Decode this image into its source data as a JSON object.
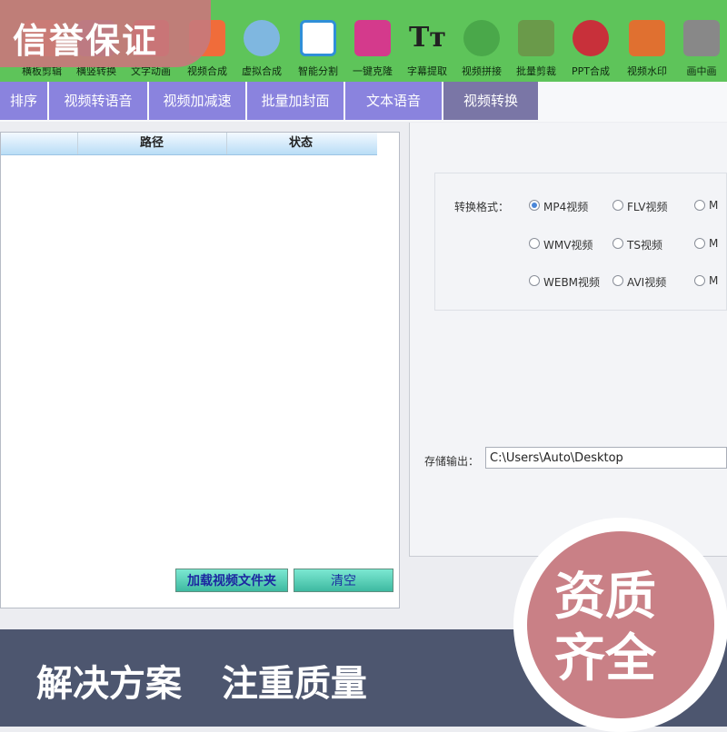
{
  "toolbar": {
    "items": [
      {
        "label": "横板剪辑",
        "icon": "clip-icon"
      },
      {
        "label": "横竖转换",
        "icon": "rotate-icon"
      },
      {
        "label": "文字动画",
        "icon": "text-animation-icon"
      },
      {
        "label": "视频合成",
        "icon": "video-merge-icon"
      },
      {
        "label": "虚拟合成",
        "icon": "virtual-avatar-icon"
      },
      {
        "label": "智能分割",
        "icon": "split-icon"
      },
      {
        "label": "一键克隆",
        "icon": "clone-icon"
      },
      {
        "label": "字幕提取",
        "icon": "subtitle-icon"
      },
      {
        "label": "视频拼接",
        "icon": "stitch-icon"
      },
      {
        "label": "批量剪裁",
        "icon": "crop-icon"
      },
      {
        "label": "PPT合成",
        "icon": "ppt-icon"
      },
      {
        "label": "视频水印",
        "icon": "watermark-icon"
      },
      {
        "label": "画中画",
        "icon": "pip-icon"
      }
    ],
    "colors": [
      "#e89a3a",
      "#3a8fd8",
      "#d94b4b",
      "#f06c3a",
      "#7fb7e0",
      "#2f8fd8",
      "#d43a8c",
      "#222222",
      "#4aa84a",
      "#6a9a4a",
      "#c8303a",
      "#e07030",
      "#888888"
    ]
  },
  "tabs": [
    {
      "label": "排序"
    },
    {
      "label": "视频转语音"
    },
    {
      "label": "视频加减速"
    },
    {
      "label": "批量加封面"
    },
    {
      "label": "文本语音"
    },
    {
      "label": "视频转换",
      "active": true
    }
  ],
  "file_list": {
    "columns": [
      "路径",
      "状态"
    ],
    "load_button": "加载视频文件夹",
    "clear_button": "清空"
  },
  "format": {
    "label": "转换格式：",
    "options": [
      "MP4视频",
      "FLV视频",
      "M",
      "WMV视频",
      "TS视频",
      "M",
      "WEBM视频",
      "AVI视频",
      "M"
    ],
    "selected": "MP4视频"
  },
  "output": {
    "label": "存储输出：",
    "value": "C:\\Users\\Auto\\Desktop"
  },
  "promo": {
    "top_badge": "信誉保证",
    "banner": "解决方案 注重质量",
    "seal_line1": "资质",
    "seal_line2": "齐全"
  },
  "colors": {
    "toolbar": "#5ec45a",
    "tab": "#8a83de",
    "tab_active": "#7a76a6",
    "badge": "#c7787b",
    "banner": "#4d566f",
    "radio_selected": "#4a86d8"
  }
}
